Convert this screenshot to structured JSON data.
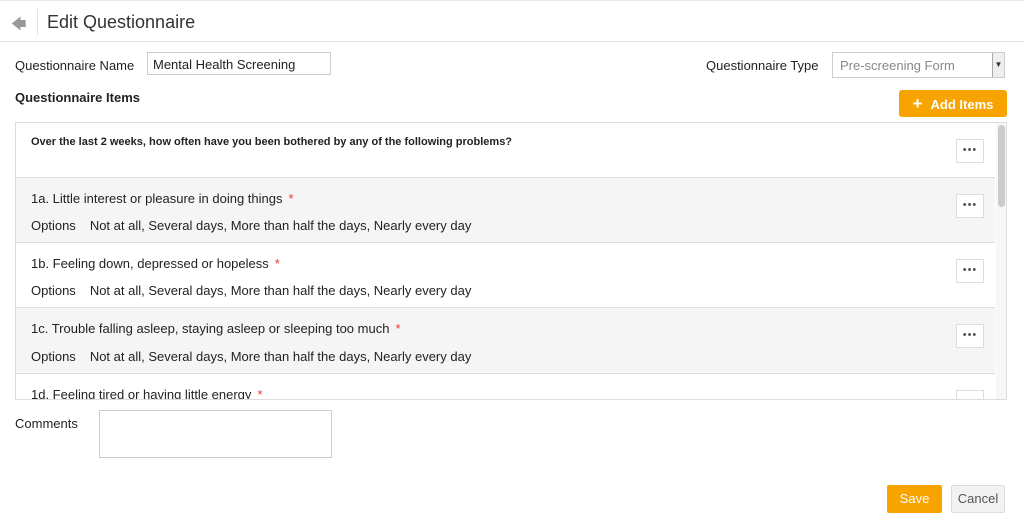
{
  "header": {
    "title": "Edit Questionnaire"
  },
  "form": {
    "name_label": "Questionnaire Name",
    "name_value": "Mental Health Screening",
    "type_label": "Questionnaire Type",
    "type_value": "Pre-screening Form",
    "items_label": "Questionnaire Items",
    "add_items_label": "Add Items",
    "comments_label": "Comments",
    "comments_value": ""
  },
  "items": [
    {
      "text": "Over the last 2 weeks, how often have you been bothered by any of the following problems?"
    },
    {
      "text": "1a. Little interest or pleasure in doing things",
      "required": "*",
      "options_label": "Options",
      "options": "Not at all, Several days, More than half the days, Nearly every day"
    },
    {
      "text": "1b. Feeling down, depressed or hopeless",
      "required": "*",
      "options_label": "Options",
      "options": "Not at all, Several days, More than half the days, Nearly every day"
    },
    {
      "text": "1c. Trouble falling asleep, staying asleep or sleeping too much",
      "required": "*",
      "options_label": "Options",
      "options": "Not at all, Several days, More than half the days, Nearly every day"
    },
    {
      "text": "1d. Feeling tired or having little energy",
      "required": "*"
    }
  ],
  "footer": {
    "save_label": "Save",
    "cancel_label": "Cancel"
  },
  "colors": {
    "accent": "#f7a400",
    "required": "#e33333"
  }
}
